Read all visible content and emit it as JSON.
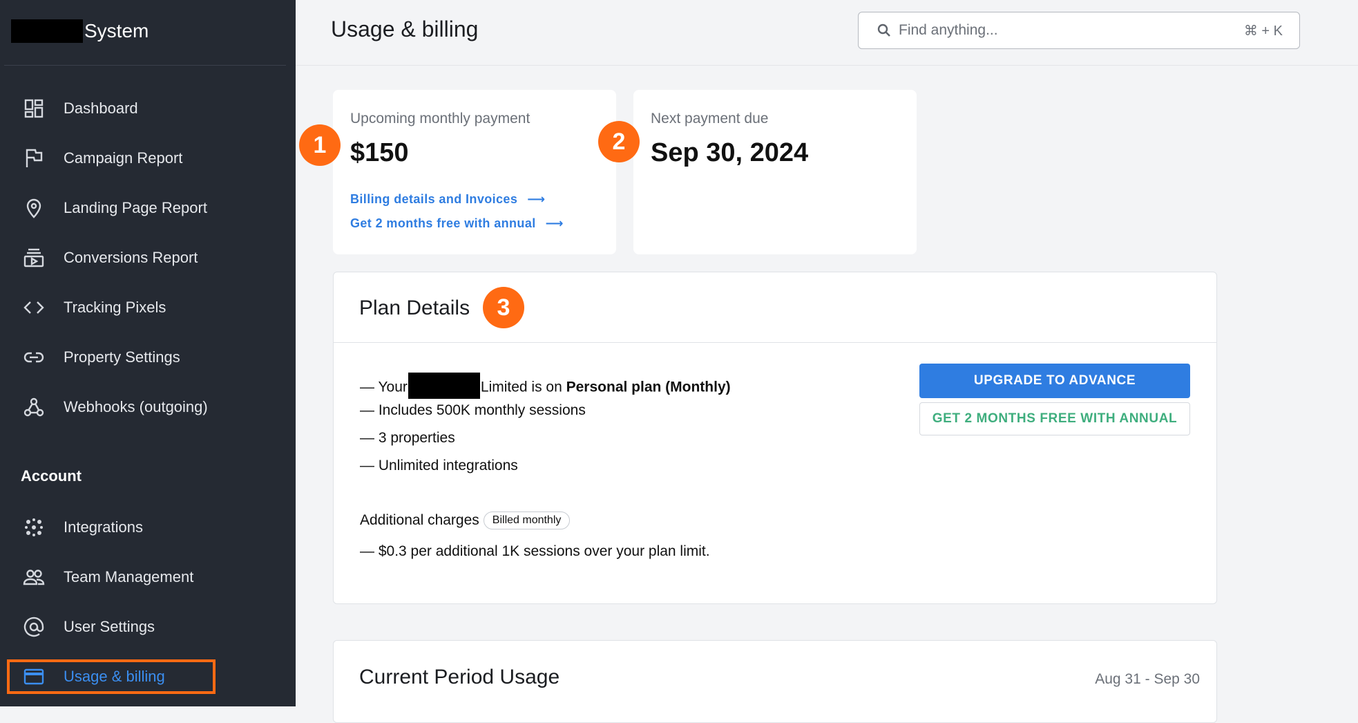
{
  "brand": {
    "name": "System"
  },
  "sidebar": {
    "items": [
      {
        "label": "Dashboard",
        "icon": "dashboard-icon"
      },
      {
        "label": "Campaign Report",
        "icon": "flag-icon"
      },
      {
        "label": "Landing Page Report",
        "icon": "location-pin-icon"
      },
      {
        "label": "Conversions Report",
        "icon": "subscriptions-icon"
      },
      {
        "label": "Tracking Pixels",
        "icon": "code-icon"
      },
      {
        "label": "Property Settings",
        "icon": "link-icon"
      },
      {
        "label": "Webhooks (outgoing)",
        "icon": "webhook-icon"
      }
    ],
    "account_label": "Account",
    "account_items": [
      {
        "label": "Integrations",
        "icon": "dots-grid-icon"
      },
      {
        "label": "Team Management",
        "icon": "people-icon"
      },
      {
        "label": "User Settings",
        "icon": "at-sign-icon"
      },
      {
        "label": "Usage & billing",
        "icon": "credit-card-icon",
        "active": true
      }
    ]
  },
  "header": {
    "title": "Usage & billing",
    "search_placeholder": "Find anything...",
    "search_shortcut": "⌘ + K"
  },
  "cards": {
    "payment": {
      "label": "Upcoming monthly payment",
      "value": "$150",
      "link1": "Billing details and Invoices",
      "link2": "Get 2 months free with annual",
      "badge": "1"
    },
    "due": {
      "label": "Next payment due",
      "value": "Sep 30, 2024",
      "badge": "2"
    }
  },
  "plan": {
    "title": "Plan Details",
    "badge": "3",
    "line1_prefix": "— Your",
    "line1_middle": "Limited is on ",
    "line1_bold": "Personal plan (Monthly)",
    "line2": "— Includes 500K monthly sessions",
    "line3": "— 3 properties",
    "line4": "— Unlimited integrations",
    "additional_label": "Additional charges",
    "additional_pill": "Billed monthly",
    "additional_line": "— $0.3 per additional 1K sessions over your plan limit.",
    "upgrade_button": "UPGRADE TO ADVANCE",
    "annual_button": "GET 2 MONTHS FREE WITH ANNUAL"
  },
  "usage": {
    "title": "Current Period Usage",
    "range": "Aug 31 - Sep 30"
  },
  "colors": {
    "sidebar_bg": "#252a33",
    "accent_blue": "#2f7de1",
    "highlight_orange": "#ff6a13",
    "secondary_green": "#3fae7e"
  }
}
